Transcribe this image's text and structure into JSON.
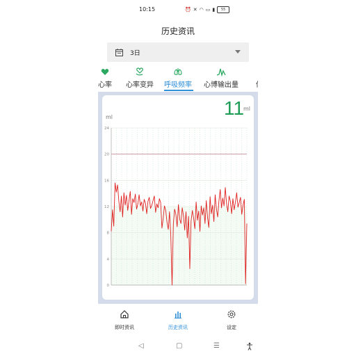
{
  "status_bar": {
    "time": "10:15",
    "icons": [
      "alarm-icon",
      "mute-icon",
      "wifi-icon",
      "sim-icon",
      "signal-icon"
    ],
    "battery": "55"
  },
  "header": {
    "title": "历史资讯"
  },
  "date_select": {
    "value": "3日",
    "icon": "calendar-icon"
  },
  "tabs": [
    {
      "label": "心率",
      "icon": "heart-rate-icon"
    },
    {
      "label": "心率变异",
      "icon": "heart-hand-icon"
    },
    {
      "label": "呼吸频率",
      "icon": "lungs-icon",
      "active": true
    },
    {
      "label": "心博输出量",
      "icon": "waveform-icon"
    },
    {
      "label": "体",
      "icon": "body-icon"
    }
  ],
  "current": {
    "value": "11",
    "unit": "ml"
  },
  "chart_data": {
    "type": "line",
    "ylabel": "ml",
    "ylim": [
      0,
      24
    ],
    "yticks": [
      0,
      4,
      8,
      12,
      16,
      20,
      24
    ],
    "reference_line": 20,
    "line_color": "#e02020",
    "reference_color": "#c99aa8",
    "grid": true,
    "series": [
      {
        "values": [
          8.2,
          11.5,
          9,
          15.6,
          14.2,
          15.3,
          12.8,
          11.2,
          13.6,
          10.4,
          14.1,
          12.2,
          13.7,
          11.4,
          12.9,
          14.3,
          10.8,
          13.2,
          12.6,
          13.9,
          11.6,
          12.4,
          13.8,
          12.1,
          12.7,
          11.3,
          13.1,
          12.5,
          10.9,
          12.8,
          13.4,
          11.7,
          12.2,
          12.9,
          13.6,
          11.1,
          12.4,
          11.8,
          13.2,
          12.6,
          8.7,
          10.2,
          12.1,
          11.4,
          9.6,
          8.5,
          11.2,
          7.5,
          0,
          9.3,
          11.6,
          10.8,
          8.9,
          12.3,
          10.1,
          9.4,
          11.8,
          10.6,
          8.4,
          11.2,
          7.2,
          10.5,
          2.5,
          9.8,
          11.4,
          10.2,
          8.6,
          12.7,
          9.9,
          11.3,
          8.2,
          12.1,
          10.7,
          11.8,
          9.4,
          12.9,
          10.3,
          8.8,
          13.5,
          10.9,
          12.2,
          9.7,
          13.8,
          11.6,
          10.4,
          12.9,
          14.6,
          11.8,
          13.3,
          12.1,
          14.9,
          12.4,
          11.2,
          13.6,
          12.8,
          10.9,
          13.2,
          11.5,
          12.7,
          14.1,
          11.9,
          12.6,
          13.4,
          10.8,
          12.2,
          13.1,
          0.2,
          9.4
        ]
      }
    ]
  },
  "bottom_nav": [
    {
      "label": "即时资讯",
      "icon": "home-icon"
    },
    {
      "label": "历史资讯",
      "icon": "bar-chart-icon",
      "active": true
    },
    {
      "label": "设定",
      "icon": "settings-icon"
    }
  ],
  "system_nav": {
    "back": "◁",
    "home": "▢",
    "recents": "☰",
    "accessibility": "accessibility-icon"
  }
}
